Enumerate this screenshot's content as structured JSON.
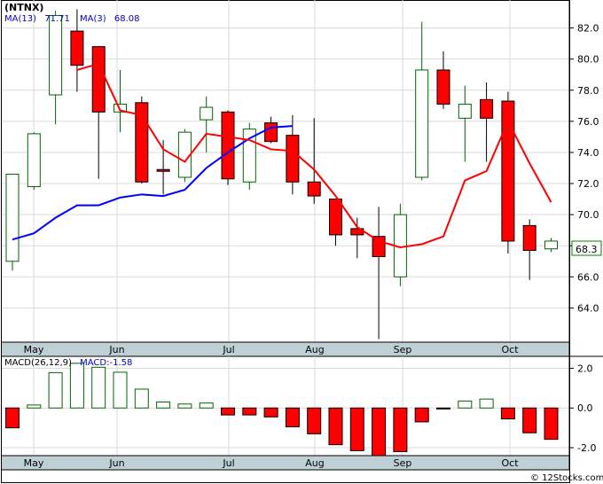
{
  "header": {
    "ticker": "(NTNX)",
    "ma13_label": "MA(13)",
    "ma13_value": "71.71",
    "ma3_label": "MA(3)",
    "ma3_value": "68.08"
  },
  "macd_header": {
    "label": "MACD(26,12,9)",
    "value_label": "MACD:-1.58"
  },
  "watermark": "© 12Stocks.com",
  "colors": {
    "up_candle_fill": "#ffffff",
    "up_candle_stroke": "#006400",
    "down_candle_fill": "#ff0000",
    "down_candle_stroke": "#000000",
    "ma13_line": "#0000ff",
    "ma3_line": "#ff0000",
    "grid": "#d9d9d9",
    "axis_band": "#bfcfd6",
    "macd_pos_stroke": "#006400",
    "macd_neg_fill": "#ff0000",
    "label_box_stroke": "#008000"
  },
  "chart_data": [
    {
      "type": "candlestick",
      "title": "(NTNX)",
      "ylim": [
        61.8,
        83.8
      ],
      "y_ticks": [
        "64.0",
        "66.0",
        "68.0",
        "70.0",
        "72.0",
        "74.0",
        "76.0",
        "78.0",
        "80.0",
        "82.0"
      ],
      "x_labels": [
        "May",
        "Jun",
        "Jul",
        "Aug",
        "Sep",
        "Oct"
      ],
      "last_price_label": "68.3",
      "candles": [
        {
          "o": 67.0,
          "h": 72.6,
          "l": 66.4,
          "c": 72.6
        },
        {
          "o": 71.8,
          "h": 75.3,
          "l": 71.6,
          "c": 75.2
        },
        {
          "o": 77.7,
          "h": 83.1,
          "l": 75.8,
          "c": 82.8
        },
        {
          "o": 81.8,
          "h": 83.2,
          "l": 77.9,
          "c": 79.6
        },
        {
          "o": 80.8,
          "h": 80.8,
          "l": 72.3,
          "c": 76.6
        },
        {
          "o": 76.6,
          "h": 79.3,
          "l": 75.3,
          "c": 77.1
        },
        {
          "o": 77.2,
          "h": 77.6,
          "l": 72.0,
          "c": 72.1
        },
        {
          "o": 72.9,
          "h": 74.8,
          "l": 71.3,
          "c": 72.8
        },
        {
          "o": 72.4,
          "h": 75.5,
          "l": 72.1,
          "c": 75.3
        },
        {
          "o": 76.1,
          "h": 77.6,
          "l": 74.0,
          "c": 76.9
        },
        {
          "o": 76.6,
          "h": 76.7,
          "l": 71.9,
          "c": 72.3
        },
        {
          "o": 72.1,
          "h": 75.9,
          "l": 71.6,
          "c": 75.5
        },
        {
          "o": 75.9,
          "h": 76.3,
          "l": 74.6,
          "c": 74.7
        },
        {
          "o": 75.1,
          "h": 76.4,
          "l": 71.3,
          "c": 72.1
        },
        {
          "o": 72.1,
          "h": 76.2,
          "l": 70.7,
          "c": 71.2
        },
        {
          "o": 71.0,
          "h": 71.0,
          "l": 68.0,
          "c": 68.7
        },
        {
          "o": 69.1,
          "h": 69.8,
          "l": 67.2,
          "c": 68.7
        },
        {
          "o": 68.6,
          "h": 70.5,
          "l": 62.0,
          "c": 67.3
        },
        {
          "o": 66.0,
          "h": 70.7,
          "l": 65.4,
          "c": 70.0
        },
        {
          "o": 72.4,
          "h": 82.4,
          "l": 72.2,
          "c": 79.3
        },
        {
          "o": 79.3,
          "h": 80.5,
          "l": 76.8,
          "c": 77.1
        },
        {
          "o": 76.2,
          "h": 78.3,
          "l": 73.4,
          "c": 77.1
        },
        {
          "o": 77.4,
          "h": 78.5,
          "l": 73.4,
          "c": 76.2
        },
        {
          "o": 77.3,
          "h": 77.9,
          "l": 67.5,
          "c": 68.3
        },
        {
          "o": 69.3,
          "h": 69.7,
          "l": 65.8,
          "c": 67.7
        },
        {
          "o": 67.8,
          "h": 68.5,
          "l": 67.6,
          "c": 68.3
        }
      ],
      "series": [
        {
          "name": "MA(13)",
          "values": [
            null,
            null,
            null,
            null,
            null,
            null,
            null,
            null,
            null,
            null,
            null,
            null,
            null,
            null,
            null,
            null,
            null,
            null,
            null,
            null,
            null,
            null,
            null,
            null,
            null,
            null
          ]
        },
        {
          "name": "MA(13)",
          "values": [
            68.4,
            68.8,
            69.8,
            70.6,
            70.6,
            71.1,
            71.3,
            71.2,
            71.6,
            73.0,
            74.0,
            74.9,
            75.6,
            75.7,
            null,
            null,
            null,
            null,
            null,
            null,
            null,
            null,
            null,
            null,
            null,
            null
          ]
        },
        {
          "name": "MA(3)",
          "values": [
            null,
            null,
            null,
            79.3,
            79.7,
            76.7,
            76.4,
            74.2,
            73.4,
            75.2,
            75.0,
            74.8,
            74.2,
            74.1,
            72.9,
            71.2,
            69.2,
            68.3,
            67.9,
            68.1,
            68.6,
            72.2,
            72.8,
            76.0,
            73.3,
            70.8
          ]
        }
      ]
    },
    {
      "type": "bar",
      "title": "MACD(26,12,9)",
      "ylim": [
        -2.4,
        2.6
      ],
      "y_ticks": [
        "2.0",
        "0.0",
        "-2.0"
      ],
      "x_labels": [
        "May",
        "Jun",
        "Jul",
        "Aug",
        "Sep",
        "Oct"
      ],
      "values": [
        -1.0,
        0.15,
        1.78,
        2.25,
        2.05,
        1.8,
        0.95,
        0.3,
        0.2,
        0.25,
        -0.35,
        -0.35,
        -0.45,
        -0.95,
        -1.3,
        -1.85,
        -2.15,
        -2.5,
        -2.2,
        -0.7,
        -0.05,
        0.35,
        0.45,
        -0.55,
        -1.25,
        -1.58
      ]
    }
  ]
}
